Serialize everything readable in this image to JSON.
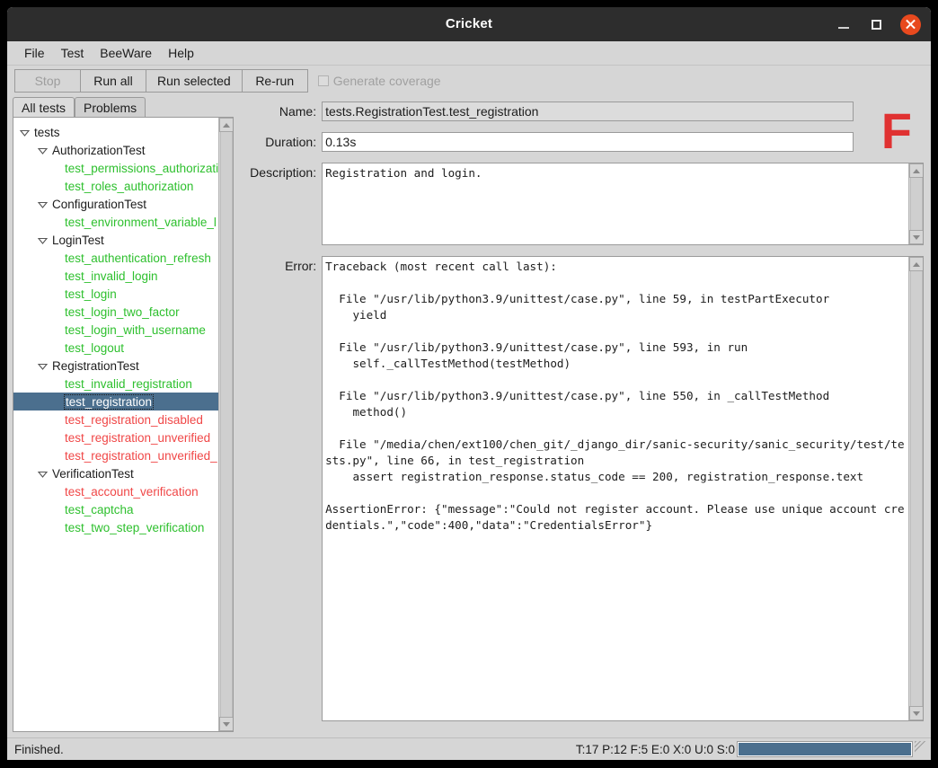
{
  "window": {
    "title": "Cricket",
    "minimize_label": "minimize",
    "maximize_label": "maximize",
    "close_label": "close"
  },
  "menubar": {
    "items": [
      {
        "label": "File"
      },
      {
        "label": "Test"
      },
      {
        "label": "BeeWare"
      },
      {
        "label": "Help"
      }
    ]
  },
  "toolbar": {
    "stop_label": "Stop",
    "run_all_label": "Run all",
    "run_selected_label": "Run selected",
    "rerun_label": "Re-run",
    "coverage_label": "Generate coverage",
    "coverage_checked": false
  },
  "tabs": [
    {
      "label": "All tests",
      "active": true
    },
    {
      "label": "Problems",
      "active": false
    }
  ],
  "tree": {
    "rows": [
      {
        "label": "tests",
        "indent": 0,
        "status": "group",
        "expander": true,
        "selected": false
      },
      {
        "label": "AuthorizationTest",
        "indent": 1,
        "status": "group",
        "expander": true,
        "selected": false
      },
      {
        "label": "test_permissions_authorizati",
        "indent": 2,
        "status": "pass",
        "expander": false,
        "selected": false
      },
      {
        "label": "test_roles_authorization",
        "indent": 2,
        "status": "pass",
        "expander": false,
        "selected": false
      },
      {
        "label": "ConfigurationTest",
        "indent": 1,
        "status": "group",
        "expander": true,
        "selected": false
      },
      {
        "label": "test_environment_variable_l",
        "indent": 2,
        "status": "pass",
        "expander": false,
        "selected": false
      },
      {
        "label": "LoginTest",
        "indent": 1,
        "status": "group",
        "expander": true,
        "selected": false
      },
      {
        "label": "test_authentication_refresh",
        "indent": 2,
        "status": "pass",
        "expander": false,
        "selected": false
      },
      {
        "label": "test_invalid_login",
        "indent": 2,
        "status": "pass",
        "expander": false,
        "selected": false
      },
      {
        "label": "test_login",
        "indent": 2,
        "status": "pass",
        "expander": false,
        "selected": false
      },
      {
        "label": "test_login_two_factor",
        "indent": 2,
        "status": "pass",
        "expander": false,
        "selected": false
      },
      {
        "label": "test_login_with_username",
        "indent": 2,
        "status": "pass",
        "expander": false,
        "selected": false
      },
      {
        "label": "test_logout",
        "indent": 2,
        "status": "pass",
        "expander": false,
        "selected": false
      },
      {
        "label": "RegistrationTest",
        "indent": 1,
        "status": "group",
        "expander": true,
        "selected": false
      },
      {
        "label": "test_invalid_registration",
        "indent": 2,
        "status": "pass",
        "expander": false,
        "selected": false
      },
      {
        "label": "test_registration",
        "indent": 2,
        "status": "selected",
        "expander": false,
        "selected": true
      },
      {
        "label": "test_registration_disabled",
        "indent": 2,
        "status": "fail",
        "expander": false,
        "selected": false
      },
      {
        "label": "test_registration_unverified",
        "indent": 2,
        "status": "fail",
        "expander": false,
        "selected": false
      },
      {
        "label": "test_registration_unverified_",
        "indent": 2,
        "status": "fail",
        "expander": false,
        "selected": false
      },
      {
        "label": "VerificationTest",
        "indent": 1,
        "status": "group",
        "expander": true,
        "selected": false
      },
      {
        "label": "test_account_verification",
        "indent": 2,
        "status": "fail",
        "expander": false,
        "selected": false
      },
      {
        "label": "test_captcha",
        "indent": 2,
        "status": "pass",
        "expander": false,
        "selected": false
      },
      {
        "label": "test_two_step_verification",
        "indent": 2,
        "status": "pass",
        "expander": false,
        "selected": false
      }
    ]
  },
  "details": {
    "name_label": "Name:",
    "name_value": "tests.RegistrationTest.test_registration",
    "duration_label": "Duration:",
    "duration_value": "0.13s",
    "description_label": "Description:",
    "description_value": "Registration and login.",
    "error_label": "Error:",
    "error_value": "Traceback (most recent call last):\n\n  File \"/usr/lib/python3.9/unittest/case.py\", line 59, in testPartExecutor\n    yield\n\n  File \"/usr/lib/python3.9/unittest/case.py\", line 593, in run\n    self._callTestMethod(testMethod)\n\n  File \"/usr/lib/python3.9/unittest/case.py\", line 550, in _callTestMethod\n    method()\n\n  File \"/media/chen/ext100/chen_git/_django_dir/sanic-security/sanic_security/test/tests.py\", line 66, in test_registration\n    assert registration_response.status_code == 200, registration_response.text\n\nAssertionError: {\"message\":\"Could not register account. Please use unique account credentials.\",\"code\":400,\"data\":\"CredentialsError\"}",
    "status_logo": "F"
  },
  "statusbar": {
    "message": "Finished.",
    "counts": "T:17 P:12 F:5 E:0 X:0 U:0 S:0",
    "progress_percent": 100
  },
  "colors": {
    "pass": "#2ec02e",
    "fail": "#f04747",
    "selection": "#4b6f8e",
    "logo": "#e03232",
    "close_button": "#e8491e"
  }
}
